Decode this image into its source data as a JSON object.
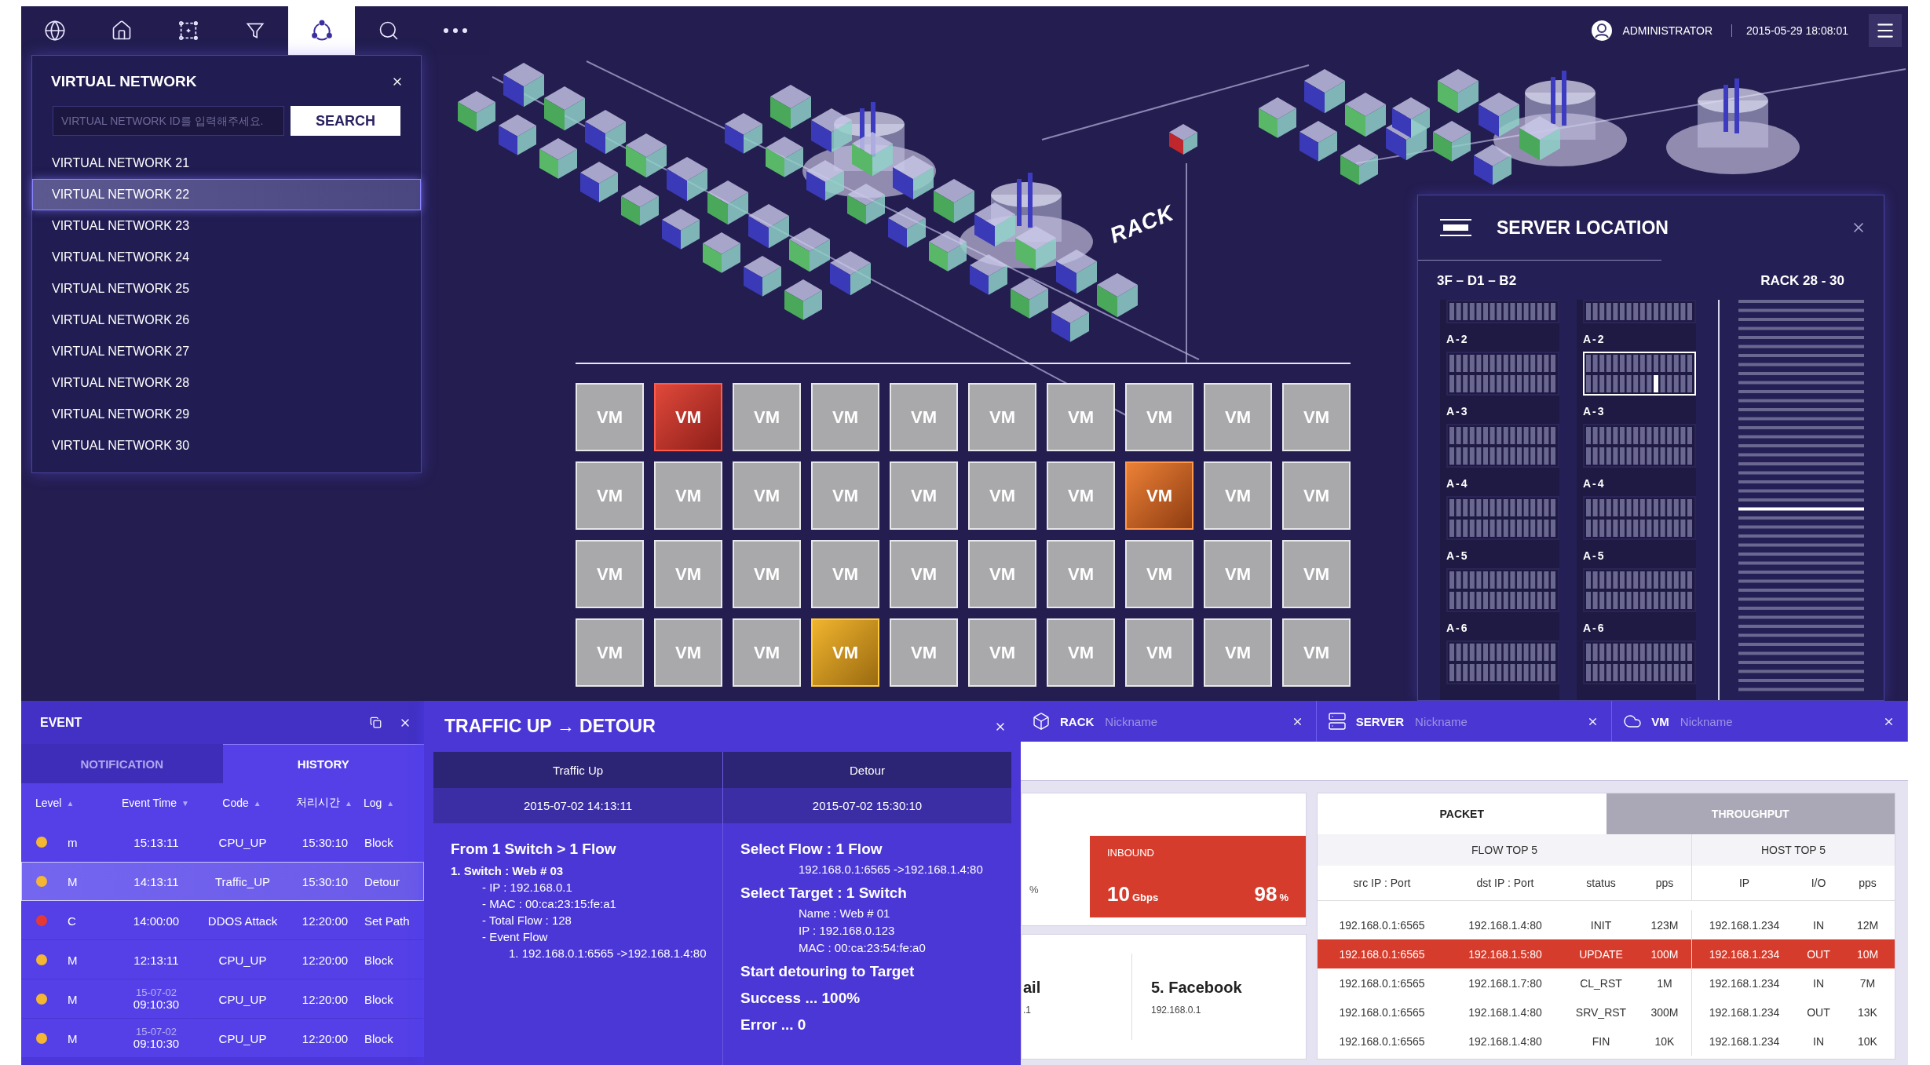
{
  "toolbar": {
    "tools": [
      {
        "kind": "globe",
        "selected": false
      },
      {
        "kind": "home",
        "selected": false
      },
      {
        "kind": "frame",
        "selected": false
      },
      {
        "kind": "filter",
        "selected": false
      },
      {
        "kind": "network",
        "selected": true
      },
      {
        "kind": "search",
        "selected": false
      },
      {
        "kind": "more",
        "selected": false
      }
    ]
  },
  "header": {
    "user": "ADMINISTRATOR",
    "datetime": "2015-05-29 18:08:01"
  },
  "canvas": {
    "label": "RACK"
  },
  "virtual_network": {
    "title": "VIRTUAL NETWORK",
    "search": {
      "placeholder": "VIRTUAL NETWORK ID를 입력해주세요.",
      "button": "SEARCH"
    },
    "items": [
      {
        "label": "VIRTUAL NETWORK 21",
        "selected": false
      },
      {
        "label": "VIRTUAL NETWORK 22",
        "selected": true
      },
      {
        "label": "VIRTUAL NETWORK 23",
        "selected": false
      },
      {
        "label": "VIRTUAL NETWORK 24",
        "selected": false
      },
      {
        "label": "VIRTUAL NETWORK 25",
        "selected": false
      },
      {
        "label": "VIRTUAL NETWORK 26",
        "selected": false
      },
      {
        "label": "VIRTUAL NETWORK 27",
        "selected": false
      },
      {
        "label": "VIRTUAL NETWORK 28",
        "selected": false
      },
      {
        "label": "VIRTUAL NETWORK 29",
        "selected": false
      },
      {
        "label": "VIRTUAL NETWORK 30",
        "selected": false
      }
    ]
  },
  "vm_grid": {
    "vms": [
      {
        "label": "VM",
        "kind": "normal"
      },
      {
        "label": "VM",
        "kind": "critical"
      },
      {
        "label": "VM",
        "kind": "normal"
      },
      {
        "label": "VM",
        "kind": "normal"
      },
      {
        "label": "VM",
        "kind": "normal"
      },
      {
        "label": "VM",
        "kind": "normal"
      },
      {
        "label": "VM",
        "kind": "normal"
      },
      {
        "label": "VM",
        "kind": "normal"
      },
      {
        "label": "VM",
        "kind": "normal"
      },
      {
        "label": "VM",
        "kind": "normal"
      },
      {
        "label": "VM",
        "kind": "normal"
      },
      {
        "label": "VM",
        "kind": "normal"
      },
      {
        "label": "VM",
        "kind": "normal"
      },
      {
        "label": "VM",
        "kind": "normal"
      },
      {
        "label": "VM",
        "kind": "normal"
      },
      {
        "label": "VM",
        "kind": "normal"
      },
      {
        "label": "VM",
        "kind": "normal"
      },
      {
        "label": "VM",
        "kind": "major"
      },
      {
        "label": "VM",
        "kind": "normal"
      },
      {
        "label": "VM",
        "kind": "normal"
      },
      {
        "label": "VM",
        "kind": "normal"
      },
      {
        "label": "VM",
        "kind": "normal"
      },
      {
        "label": "VM",
        "kind": "normal"
      },
      {
        "label": "VM",
        "kind": "normal"
      },
      {
        "label": "VM",
        "kind": "normal"
      },
      {
        "label": "VM",
        "kind": "normal"
      },
      {
        "label": "VM",
        "kind": "normal"
      },
      {
        "label": "VM",
        "kind": "normal"
      },
      {
        "label": "VM",
        "kind": "normal"
      },
      {
        "label": "VM",
        "kind": "normal"
      },
      {
        "label": "VM",
        "kind": "normal"
      },
      {
        "label": "VM",
        "kind": "normal"
      },
      {
        "label": "VM",
        "kind": "normal"
      },
      {
        "label": "VM",
        "kind": "minor"
      },
      {
        "label": "VM",
        "kind": "normal"
      },
      {
        "label": "VM",
        "kind": "normal"
      },
      {
        "label": "VM",
        "kind": "normal"
      },
      {
        "label": "VM",
        "kind": "normal"
      },
      {
        "label": "VM",
        "kind": "normal"
      },
      {
        "label": "VM",
        "kind": "normal"
      }
    ]
  },
  "server_location": {
    "title": "SERVER LOCATION",
    "floor": "3F – D1 – B2",
    "rack": "RACK 28 - 30",
    "columns": [
      {
        "groups": [
          {
            "selected": false
          },
          {
            "label": "A-2",
            "selected": false
          },
          {
            "label": "A-3",
            "selected": false
          },
          {
            "label": "A-4",
            "selected": false
          },
          {
            "label": "A-5",
            "selected": false
          },
          {
            "label": "A-6",
            "selected": false
          }
        ]
      },
      {
        "groups": [
          {
            "selected": false
          },
          {
            "label": "A-2",
            "selected": true
          },
          {
            "label": "A-3",
            "selected": false
          },
          {
            "label": "A-4",
            "selected": false
          },
          {
            "label": "A-5",
            "selected": false
          },
          {
            "label": "A-6",
            "selected": false
          }
        ]
      }
    ]
  },
  "event": {
    "title": "EVENT",
    "tabs": [
      {
        "label": "NOTIFICATION",
        "selected": false
      },
      {
        "label": "HISTORY",
        "selected": true
      }
    ],
    "columns": [
      {
        "label": "Level",
        "sort": "▲"
      },
      {
        "label": "Event Time",
        "sort": "▼"
      },
      {
        "label": "Code",
        "sort": "▲"
      },
      {
        "label": "처리시간",
        "sort": "▲"
      },
      {
        "label": "Log",
        "sort": "▲"
      }
    ],
    "rows": [
      {
        "color": "#f5b731",
        "level": "m",
        "time": "15:13:11",
        "code": "CPU_UP",
        "processed": "15:30:10",
        "log": "Block",
        "selected": false
      },
      {
        "color": "#f5b731",
        "level": "M",
        "time": "14:13:11",
        "code": "Traffic_UP",
        "processed": "15:30:10",
        "log": "Detour",
        "selected": true
      },
      {
        "color": "#e53935",
        "level": "C",
        "time": "14:00:00",
        "code": "DDOS Attack",
        "processed": "12:20:00",
        "log": "Set Path",
        "selected": false
      },
      {
        "color": "#f5b731",
        "level": "M",
        "time": "12:13:11",
        "code": "CPU_UP",
        "processed": "12:20:00",
        "log": "Block",
        "selected": false
      },
      {
        "color": "#f5b731",
        "level": "M",
        "date": "15-07-02",
        "time": "09:10:30",
        "code": "CPU_UP",
        "processed": "12:20:00",
        "log": "Block",
        "selected": false
      },
      {
        "color": "#f5b731",
        "level": "M",
        "date": "15-07-02",
        "time": "09:10:30",
        "code": "CPU_UP",
        "processed": "12:20:00",
        "log": "Block",
        "selected": false
      }
    ]
  },
  "traffic": {
    "title": "TRAFFIC UP → DETOUR",
    "columns": [
      {
        "heading": "Traffic Up",
        "date": "2015-07-02 14:13:11",
        "lines": [
          {
            "kind": "heading",
            "text": "From 1 Switch > 1 Flow"
          },
          {
            "kind": "subheading",
            "text": "1. Switch : Web # 03"
          },
          {
            "kind": "item",
            "text": "- IP : 192.168.0.1"
          },
          {
            "kind": "item",
            "text": "- MAC : 00:ca:23:15:fe:a1"
          },
          {
            "kind": "item",
            "text": "- Total Flow : 128"
          },
          {
            "kind": "item",
            "text": "- Event Flow"
          },
          {
            "kind": "subitem",
            "text": "1. 192.168.0.1:6565 ->192.168.1.4:80"
          }
        ]
      },
      {
        "heading": "Detour",
        "date": "2015-07-02 15:30:10",
        "lines": [
          {
            "kind": "heading",
            "text": "Select Flow : 1 Flow"
          },
          {
            "kind": "detail",
            "text": "192.168.0.1:6565 ->192.168.1.4:80"
          },
          {
            "kind": "heading",
            "text": "Select Target : 1 Switch"
          },
          {
            "kind": "detail",
            "text": "Name : Web # 01"
          },
          {
            "kind": "detail",
            "text": "IP : 192.168.0.123"
          },
          {
            "kind": "detail",
            "text": "MAC : 00:ca:23:54:fe:a0"
          },
          {
            "kind": "heading",
            "text": "Start detouring to Target"
          },
          {
            "kind": "heading",
            "text": "Success ... 100%"
          },
          {
            "kind": "heading",
            "text": "Error ... 0"
          }
        ]
      }
    ]
  },
  "detail_tabs": [
    {
      "kind": "rack",
      "label": "RACK",
      "placeholder": "Nickname"
    },
    {
      "kind": "server",
      "label": "SERVER",
      "placeholder": "Nickname"
    },
    {
      "kind": "vm",
      "label": "VM",
      "placeholder": "Nickname"
    }
  ],
  "summary": {
    "fragment": "%",
    "inbound": {
      "label": "INBOUND",
      "value": "10",
      "unit": "Gbps",
      "percent": "98",
      "percent_unit": "%"
    }
  },
  "top_sites": [
    {
      "name": "ail",
      "ip": ".1"
    },
    {
      "name": "5. Facebook",
      "ip": "192.168.0.1"
    }
  ],
  "packet": {
    "tabs": [
      {
        "label": "PACKET",
        "selected": true
      },
      {
        "label": "THROUGHPUT",
        "selected": false
      }
    ],
    "flow_title": "FLOW TOP 5",
    "host_title": "HOST TOP 5",
    "columns": [
      "src IP : Port",
      "dst IP : Port",
      "status",
      "pps",
      "IP",
      "I/O",
      "pps"
    ],
    "rows": [
      {
        "highlighted": false,
        "cells": [
          "192.168.0.1:6565",
          "192.168.1.4:80",
          "INIT",
          "123M",
          "192.168.1.234",
          "IN",
          "12M"
        ]
      },
      {
        "highlighted": true,
        "cells": [
          "192.168.0.1:6565",
          "192.168.1.5:80",
          "UPDATE",
          "100M",
          "192.168.1.234",
          "OUT",
          "10M"
        ]
      },
      {
        "highlighted": false,
        "cells": [
          "192.168.0.1:6565",
          "192.168.1.7:80",
          "CL_RST",
          "1M",
          "192.168.1.234",
          "IN",
          "7M"
        ]
      },
      {
        "highlighted": false,
        "cells": [
          "192.168.0.1:6565",
          "192.168.1.4:80",
          "SRV_RST",
          "300M",
          "192.168.1.234",
          "OUT",
          "13K"
        ]
      },
      {
        "highlighted": false,
        "cells": [
          "192.168.0.1:6565",
          "192.168.1.4:80",
          "FIN",
          "10K",
          "192.168.1.234",
          "IN",
          "10K"
        ]
      }
    ]
  }
}
